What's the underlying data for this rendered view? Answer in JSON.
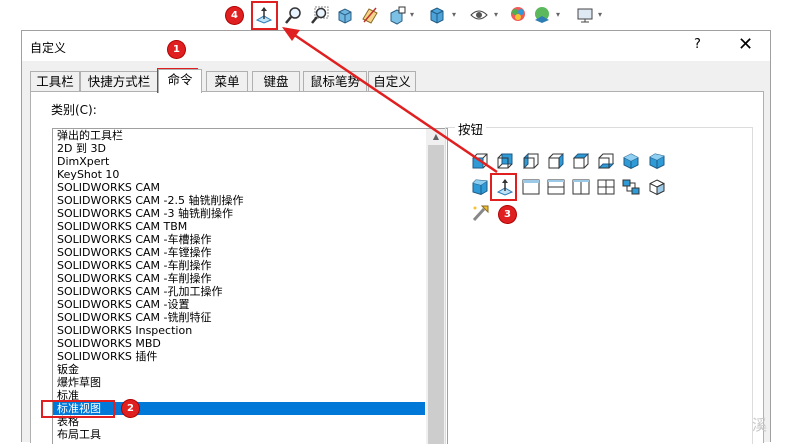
{
  "toolbar": {
    "icons": [
      "normal-to-icon",
      "zoom-to-fit-icon",
      "zoom-area-icon",
      "previous-view-icon",
      "section-view-icon",
      "dynamic-annotation-icon",
      "view-orientation-icon",
      "display-style-icon",
      "hide-show-icon",
      "edit-appearance-icon",
      "apply-scene-icon",
      "view-settings-icon"
    ],
    "caret": "▾"
  },
  "dialog": {
    "title": "自定义",
    "help": "?",
    "close": "✕"
  },
  "tabs": [
    "工具栏",
    "快捷方式栏",
    "命令",
    "菜单",
    "键盘",
    "鼠标笔势",
    "自定义"
  ],
  "active_tab": "命令",
  "category": {
    "label": "类别(C):",
    "items": [
      "弹出的工具栏",
      "2D 到 3D",
      "DimXpert",
      "KeyShot 10",
      "SOLIDWORKS CAM",
      "SOLIDWORKS CAM -2.5 轴铣削操作",
      "SOLIDWORKS CAM -3 轴铣削操作",
      "SOLIDWORKS CAM TBM",
      "SOLIDWORKS CAM -车槽操作",
      "SOLIDWORKS CAM -车镗操作",
      "SOLIDWORKS CAM -车削操作",
      "SOLIDWORKS CAM -车削操作",
      "SOLIDWORKS CAM -孔加工操作",
      "SOLIDWORKS CAM -设置",
      "SOLIDWORKS CAM -铣削特征",
      "SOLIDWORKS Inspection",
      "SOLIDWORKS MBD",
      "SOLIDWORKS 插件",
      "钣金",
      "爆炸草图",
      "标准",
      "标准视图",
      "表格",
      "布局工具"
    ],
    "selected_index": 21
  },
  "buttons_group": {
    "label": "按钮",
    "icons": [
      "front-view-icon",
      "back-view-icon",
      "left-view-icon",
      "right-view-icon",
      "top-view-icon",
      "bottom-view-icon",
      "isometric-view-icon",
      "trimetric-view-icon",
      "dimetric-view-icon",
      "normal-to-icon",
      "single-view-icon",
      "two-view-horizontal-icon",
      "two-view-vertical-icon",
      "four-view-icon",
      "link-views-icon",
      "view-selector-icon",
      "view-orientation-wand-icon"
    ]
  },
  "annotations": [
    "1",
    "2",
    "3",
    "4"
  ],
  "colors": {
    "selection": "#0078d7",
    "annotation_red": "#e02020",
    "cube_blue": "#2e9ad6"
  },
  "watermark": "溪"
}
